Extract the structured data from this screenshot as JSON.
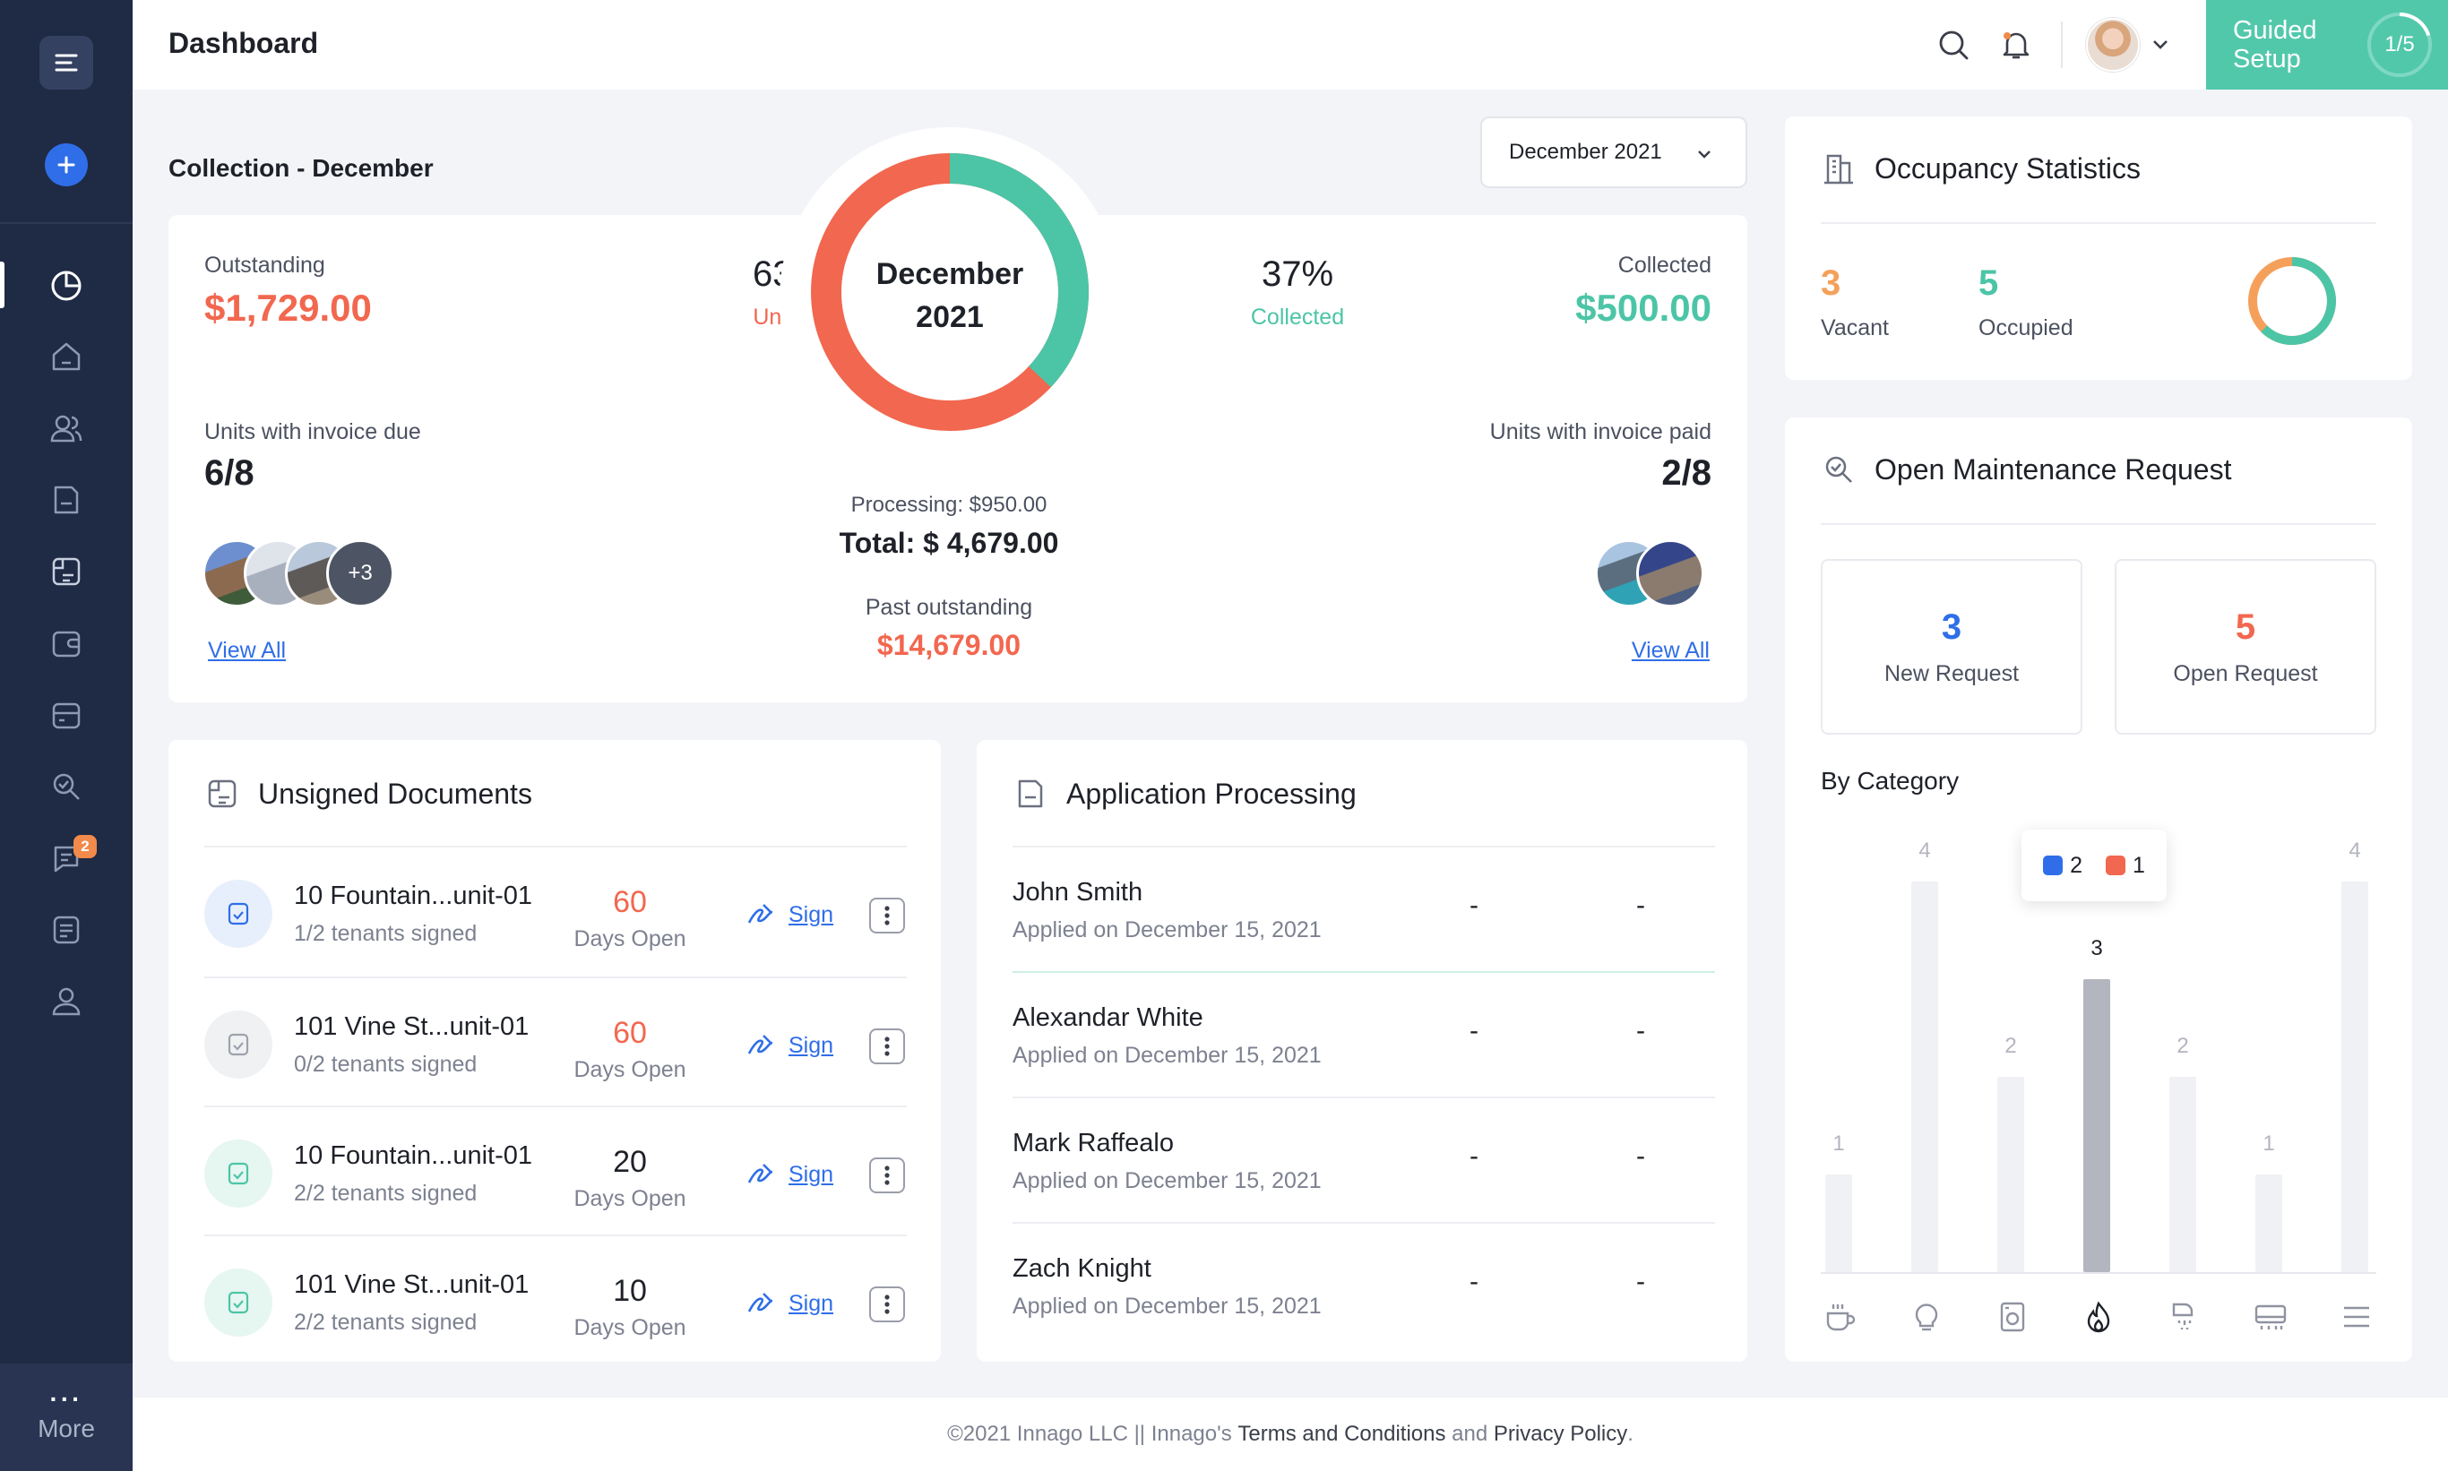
{
  "header": {
    "title": "Dashboard",
    "guided_label_1": "Guided",
    "guided_label_2": "Setup",
    "guided_progress": "1/5"
  },
  "sidebar": {
    "more_label": "More",
    "messages_badge": "2"
  },
  "collection": {
    "title": "Collection - December",
    "month_select": "December 2021",
    "outstanding_label": "Outstanding",
    "outstanding_value": "$1,729.00",
    "unpaid_pct": "63%",
    "unpaid_label": "Unpaid",
    "center_line1": "December",
    "center_line2": "2021",
    "collected_pct": "37%",
    "collected_pct_label": "Collected",
    "collected_label": "Collected",
    "collected_value": "$500.00",
    "units_due_label": "Units with invoice due",
    "units_due_value": "6/8",
    "units_paid_label": "Units with invoice paid",
    "units_paid_value": "2/8",
    "extra_count": "+3",
    "view_all": "View All",
    "processing": "Processing: $950.00",
    "total": "Total: $ 4,679.00",
    "past_label": "Past outstanding",
    "past_value": "$14,679.00"
  },
  "occupancy": {
    "title": "Occupancy Statistics",
    "vacant_value": "3",
    "vacant_label": "Vacant",
    "occupied_value": "5",
    "occupied_label": "Occupied"
  },
  "maintenance": {
    "title": "Open Maintenance Request",
    "new_value": "3",
    "new_label": "New Request",
    "open_value": "5",
    "open_label": "Open Request",
    "by_category": "By Category",
    "tooltip_blue": "2",
    "tooltip_red": "1"
  },
  "chart_data": {
    "type": "bar",
    "title": "By Category",
    "categories": [
      "appliances",
      "electrical",
      "laundry",
      "fire-safety",
      "plumbing",
      "hvac",
      "other"
    ],
    "values": [
      1,
      4,
      2,
      3,
      2,
      1,
      4
    ],
    "highlighted_index": 3,
    "tooltip": {
      "blue": 2,
      "red": 1
    },
    "colors": {
      "bar": "#f0f1f5",
      "highlight": "#b3b5bf",
      "blue": "#2f6ee8",
      "red": "#f2674f"
    }
  },
  "documents": {
    "title": "Unsigned Documents",
    "sign_label": "Sign",
    "days_label": "Days Open",
    "items": [
      {
        "name": "10 Fountain...unit-01",
        "tenants": "1/2 tenants signed",
        "days": "60"
      },
      {
        "name": "101 Vine St...unit-01",
        "tenants": "0/2 tenants signed",
        "days": "60"
      },
      {
        "name": "10 Fountain...unit-01",
        "tenants": "2/2 tenants signed",
        "days": "20"
      },
      {
        "name": "101 Vine St...unit-01",
        "tenants": "2/2 tenants signed",
        "days": "10"
      }
    ]
  },
  "applications": {
    "title": "Application Processing",
    "dash": "-",
    "items": [
      {
        "name": "John Smith",
        "applied": "Applied on December 15, 2021"
      },
      {
        "name": "Alexandar White",
        "applied": "Applied on December 15, 2021"
      },
      {
        "name": "Mark Raffealo",
        "applied": "Applied on December 15, 2021"
      },
      {
        "name": "Zach Knight",
        "applied": "Applied on December 15, 2021"
      }
    ]
  },
  "footer": {
    "copyright": "©2021 Innago LLC || Innago's",
    "terms": "Terms and Conditions",
    "and": "and",
    "privacy": "Privacy Policy",
    "period": "."
  },
  "colors": {
    "sidebar": "#1f2a44",
    "accent": "#2f6ee8",
    "green": "#4cc5a6",
    "red": "#f2674f",
    "orange": "#f5a05a"
  }
}
